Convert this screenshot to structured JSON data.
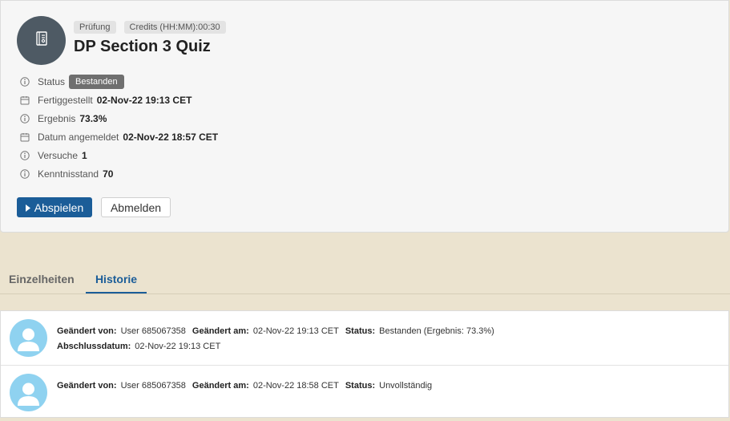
{
  "header": {
    "badge_type": "Prüfung",
    "badge_credits": "Credits (HH:MM):00:30",
    "title": "DP Section 3 Quiz"
  },
  "meta": {
    "status_label": "Status",
    "status_value": "Bestanden",
    "completed_label": "Fertiggestellt",
    "completed_value": "02-Nov-22 19:13 CET",
    "result_label": "Ergebnis",
    "result_value": "73.3%",
    "registered_label": "Datum angemeldet",
    "registered_value": "02-Nov-22 18:57 CET",
    "attempts_label": "Versuche",
    "attempts_value": "1",
    "knowledge_label": "Kenntnisstand",
    "knowledge_value": "70"
  },
  "actions": {
    "play": "Abspielen",
    "unregister": "Abmelden"
  },
  "tabs": {
    "details": "Einzelheiten",
    "history": "Historie"
  },
  "history": [
    {
      "changed_by_label": "Geändert von:",
      "changed_by": "User 685067358",
      "changed_on_label": "Geändert am:",
      "changed_on": "02-Nov-22 19:13 CET",
      "status_label": "Status:",
      "status": "Bestanden (Ergebnis: 73.3%)",
      "completion_label": "Abschlussdatum:",
      "completion": "02-Nov-22 19:13 CET"
    },
    {
      "changed_by_label": "Geändert von:",
      "changed_by": "User 685067358",
      "changed_on_label": "Geändert am:",
      "changed_on": "02-Nov-22 18:58 CET",
      "status_label": "Status:",
      "status": "Unvollständig"
    }
  ],
  "icons": {
    "course": "course-icon",
    "info": "info-icon",
    "calendar": "calendar-icon",
    "play": "play-triangle-icon",
    "user": "user-silhouette-icon"
  },
  "colors": {
    "accent": "#1b5d98",
    "status_pill": "#6f6f6f",
    "avatar_bg": "#4e5a64",
    "user_avatar_bg": "#8fd2f0",
    "page_bg": "#ebe3cf"
  }
}
